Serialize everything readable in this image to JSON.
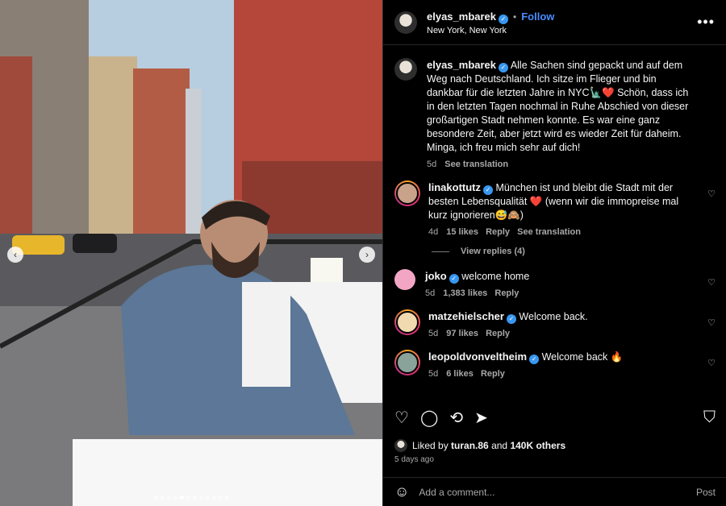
{
  "post": {
    "username": "elyas_mbarek",
    "follow_label": "Follow",
    "separator": "•",
    "location": "New York, New York",
    "more_label": "•••"
  },
  "caption": {
    "username": "elyas_mbarek",
    "text": "Alle Sachen sind gepackt und auf dem Weg nach Deutschland. Ich sitze im Flieger und bin dankbar für die letzten Jahre in NYC🗽❤️ Schön, dass ich in den letzten Tagen nochmal in Ruhe Abschied von dieser großartigen Stadt nehmen konnte. Es war eine ganz besondere Zeit, aber jetzt wird es wieder Zeit für daheim. Minga, ich freu mich sehr auf dich!",
    "age": "5d",
    "translate": "See translation"
  },
  "comments": [
    {
      "username": "linakottutz",
      "text": "München ist und bleibt die Stadt mit der besten Lebensqualität ❤️ (wenn wir die immopreise mal kurz ignorieren😅🙈)",
      "age": "4d",
      "likes": "15 likes",
      "reply": "Reply",
      "translate": "See translation",
      "view_replies": "View replies (4)"
    },
    {
      "username": "joko",
      "text": "welcome home",
      "age": "5d",
      "likes": "1,383 likes",
      "reply": "Reply"
    },
    {
      "username": "matzehielscher",
      "text": "Welcome back.",
      "age": "5d",
      "likes": "97 likes",
      "reply": "Reply"
    },
    {
      "username": "leopoldvonveltheim",
      "text": "Welcome back 🔥",
      "age": "5d",
      "likes": "6 likes",
      "reply": "Reply"
    }
  ],
  "actions": {
    "like_icon": "heart-icon",
    "comment_icon": "comment-icon",
    "repost_icon": "repost-icon",
    "share_icon": "share-icon",
    "save_icon": "bookmark-icon"
  },
  "likes": {
    "prefix": "Liked by",
    "user": "turan.86",
    "and": "and",
    "others": "140K others"
  },
  "time_ago": "5 days ago",
  "comment_box": {
    "placeholder": "Add a comment...",
    "post_label": "Post"
  },
  "carousel": {
    "slide_count": 12,
    "active_index": 4
  },
  "colors": {
    "accent": "#4a8cff",
    "verified": "#3897f0",
    "background": "#000000",
    "muted_text": "#a8a8a8"
  }
}
